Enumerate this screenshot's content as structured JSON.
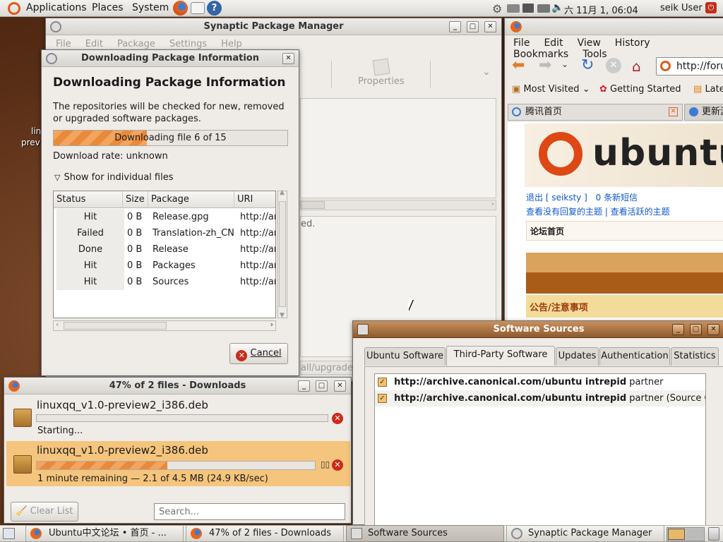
{
  "top_panel": {
    "menus": [
      "Applications",
      "Places",
      "System"
    ],
    "clock": "六 11月  1, 06:04",
    "user": "seik User"
  },
  "desktop": {
    "label_line1": "lin",
    "label_line2": "prev"
  },
  "synaptic": {
    "title": "Synaptic Package Manager",
    "menus": [
      "File",
      "Edit",
      "Package",
      "Settings",
      "Help"
    ],
    "properties_label": "Properties",
    "status_fragment": "ed.",
    "path_fragment": "all/upgrade."
  },
  "dialog": {
    "title": "Downloading Package Information",
    "heading": "Downloading Package Information",
    "description": "The repositories will be checked for new, removed or upgraded software packages.",
    "progress_text": "Downloading file 6 of 15",
    "progress_fraction": 0.4,
    "rate": "Download rate: unknown",
    "expander": "Show for individual files",
    "columns": [
      "Status",
      "Size",
      "Package",
      "URI"
    ],
    "rows": [
      {
        "status": "Hit",
        "size": "0  B",
        "package": "Release.gpg",
        "uri": "http://ar"
      },
      {
        "status": "Failed",
        "size": "0  B",
        "package": "Translation-zh_CN",
        "uri": "http://ar"
      },
      {
        "status": "Done",
        "size": "0  B",
        "package": "Release",
        "uri": "http://ar"
      },
      {
        "status": "Hit",
        "size": "0  B",
        "package": "Packages",
        "uri": "http://ar"
      },
      {
        "status": "Hit",
        "size": "0  B",
        "package": "Sources",
        "uri": "http://ar"
      }
    ],
    "cancel_label": "Cancel"
  },
  "downloads": {
    "title": "47% of 2 files - Downloads",
    "items": [
      {
        "name": "linuxqq_v1.0-preview2_i386.deb",
        "status": "Starting...",
        "progress": 0
      },
      {
        "name": "linuxqq_v1.0-preview2_i386.deb",
        "status": "1 minute remaining — 2.1 of 4.5 MB (24.9 KB/sec)",
        "progress": 0.47
      }
    ],
    "clear_label": "Clear List",
    "search_placeholder": "Search..."
  },
  "firefox": {
    "menus": [
      "File",
      "Edit",
      "View",
      "History",
      "Bookmarks",
      "Tools"
    ],
    "url": "http://foru",
    "bookmarks": [
      "Most Visited",
      "Getting Started",
      "Late"
    ],
    "tabs": [
      "腾讯首页",
      "更新源"
    ],
    "logo_text": "ubuntu",
    "logout": "退出 [ seiksty ]",
    "messages": "0 条新短信",
    "links": "查看没有回复的主题 | 查看活跃的主题",
    "forum_home": "论坛首页",
    "notice": "公告/注意事项"
  },
  "software_sources": {
    "title": "Software Sources",
    "tabs": [
      "Ubuntu Software",
      "Third-Party Software",
      "Updates",
      "Authentication",
      "Statistics"
    ],
    "selected_tab": 1,
    "entries": [
      {
        "url": "http://archive.canonical.com/ubuntu intrepid",
        "rest": "partner"
      },
      {
        "url": "http://archive.canonical.com/ubuntu intrepid",
        "rest": "partner (Source C"
      }
    ]
  },
  "taskbar": [
    {
      "label": "Ubuntu中文论坛 • 首页 - ..."
    },
    {
      "label": "47% of 2 files - Downloads"
    },
    {
      "label": "Software Sources"
    },
    {
      "label": "Synaptic Package Manager"
    }
  ],
  "colors": {
    "accent": "#e98a3a",
    "title_active": "#a06a3a",
    "error": "#cc2a1a"
  }
}
